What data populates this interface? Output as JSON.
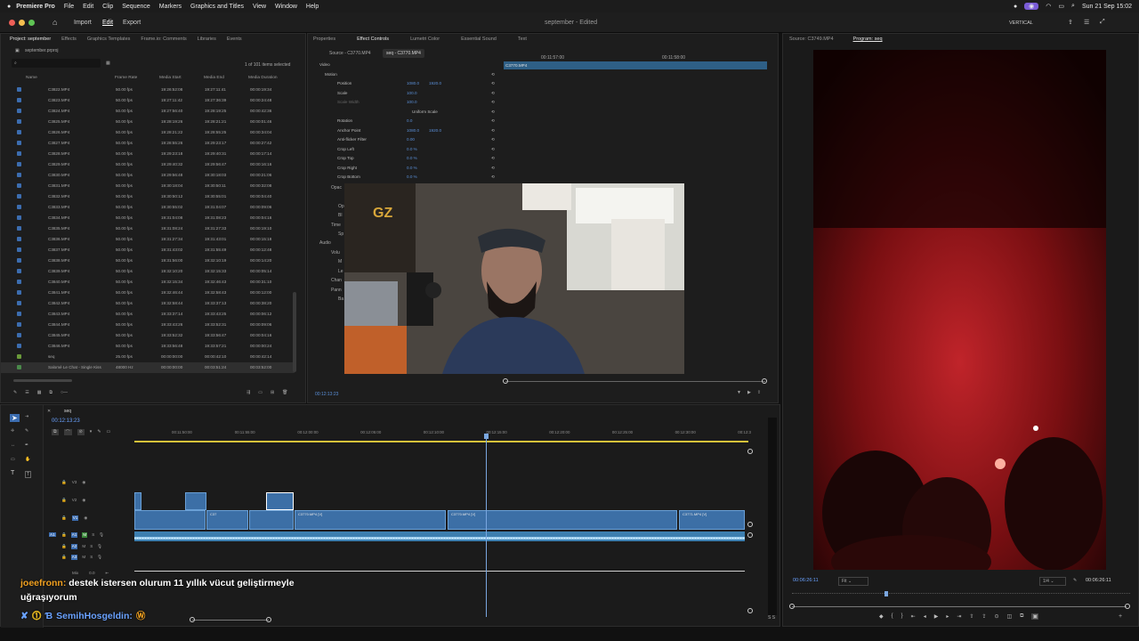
{
  "menubar": {
    "app": "Premiere Pro",
    "items": [
      "File",
      "Edit",
      "Clip",
      "Sequence",
      "Markers",
      "Graphics and Titles",
      "View",
      "Window",
      "Help"
    ],
    "datetime": "Sun 21 Sep  15:02"
  },
  "titlebar": {
    "nav": [
      "Import",
      "Edit",
      "Export"
    ],
    "title": "september - Edited",
    "workspace": "VERTICAL"
  },
  "project_panel": {
    "tabs": [
      "Project: september",
      "Effects",
      "Graphics Templates",
      "Frame.io: Comments",
      "Libraries",
      "Events"
    ],
    "file": "september.prproj",
    "items_selected": "1 of 101 items selected",
    "columns": [
      "Name",
      "Frame Rate",
      "Media Start",
      "Media End",
      "Media Duration"
    ],
    "rows": [
      [
        "C3822.MP4",
        "50.00 fps",
        "19:26:52:08",
        "19:27:11:41",
        "00:00:19:34"
      ],
      [
        "C3823.MP4",
        "50.00 fps",
        "19:27:11:42",
        "19:27:36:39",
        "00:00:24:48"
      ],
      [
        "C3824.MP4",
        "50.00 fps",
        "19:27:56:40",
        "19:28:19:25",
        "00:00:42:36"
      ],
      [
        "C3825.MP4",
        "50.00 fps",
        "19:28:19:26",
        "19:28:21:21",
        "00:00:01:46"
      ],
      [
        "C3826.MP4",
        "50.00 fps",
        "19:28:21:22",
        "19:28:55:25",
        "00:00:34:04"
      ],
      [
        "C3827.MP4",
        "50.00 fps",
        "19:28:55:26",
        "19:29:23:17",
        "00:00:27:42"
      ],
      [
        "C3828.MP4",
        "50.00 fps",
        "19:29:23:18",
        "19:29:40:31",
        "00:00:17:14"
      ],
      [
        "C3829.MP4",
        "50.00 fps",
        "19:29:40:32",
        "19:29:56:47",
        "00:00:16:16"
      ],
      [
        "C3830.MP4",
        "50.00 fps",
        "19:29:56:48",
        "19:30:18:03",
        "00:00:21:06"
      ],
      [
        "C3831.MP4",
        "50.00 fps",
        "19:30:18:04",
        "19:30:50:11",
        "00:00:32:08"
      ],
      [
        "C3832.MP4",
        "50.00 fps",
        "19:30:50:12",
        "19:30:55:01",
        "00:00:04:40"
      ],
      [
        "C3833.MP4",
        "50.00 fps",
        "19:30:55:02",
        "19:31:04:07",
        "00:00:09:06"
      ],
      [
        "C3834.MP4",
        "50.00 fps",
        "19:31:04:08",
        "19:31:08:23",
        "00:00:04:16"
      ],
      [
        "C3835.MP4",
        "50.00 fps",
        "19:31:08:24",
        "19:31:27:33",
        "00:00:19:10"
      ],
      [
        "C3836.MP4",
        "50.00 fps",
        "19:31:27:34",
        "19:31:43:01",
        "00:00:15:18"
      ],
      [
        "C3837.MP4",
        "50.00 fps",
        "19:31:43:02",
        "19:31:55:49",
        "00:00:12:48"
      ],
      [
        "C3838.MP4",
        "50.00 fps",
        "19:31:56:00",
        "19:32:10:19",
        "00:00:14:20"
      ],
      [
        "C3839.MP4",
        "50.00 fps",
        "19:32:10:20",
        "19:32:15:33",
        "00:00:05:14"
      ],
      [
        "C3840.MP4",
        "50.00 fps",
        "19:32:15:34",
        "19:32:46:43",
        "00:00:31:10"
      ],
      [
        "C3841.MP4",
        "50.00 fps",
        "19:32:46:44",
        "19:32:58:43",
        "00:00:12:00"
      ],
      [
        "C3842.MP4",
        "50.00 fps",
        "19:32:58:44",
        "19:33:37:13",
        "00:00:38:20"
      ],
      [
        "C3843.MP4",
        "50.00 fps",
        "19:33:37:14",
        "19:33:43:25",
        "00:00:06:12"
      ],
      [
        "C3844.MP4",
        "50.00 fps",
        "19:33:43:26",
        "19:33:52:31",
        "00:00:09:06"
      ],
      [
        "C3845.MP4",
        "50.00 fps",
        "19:33:52:32",
        "19:33:56:47",
        "00:00:04:16"
      ],
      [
        "C3846.MP4",
        "50.00 fps",
        "19:33:56:48",
        "19:33:57:21",
        "00:00:00:24"
      ],
      [
        "seq",
        "25.00 fps",
        "00:00:00:00",
        "00:00:42:10",
        "00:00:42:14"
      ],
      [
        "Salomé Le Chat - Single Kiss",
        "48000 Hz",
        "00:00:00:00",
        "00:03:51:24",
        "00:03:52:00"
      ]
    ]
  },
  "effect_controls": {
    "tabs": [
      "Properties",
      "Effect Controls",
      "Lumetri Color",
      "Essential Sound",
      "Text"
    ],
    "source_tabs": [
      "Source - C3770.MP4",
      "seq - C3770.MP4"
    ],
    "ruler": [
      "00:11:57:00",
      "00:11:58:00"
    ],
    "clip_name": "C3770.MP4",
    "timecode": "00:12:13:23",
    "rows": [
      {
        "label": "Video",
        "v1": "",
        "v2": ""
      },
      {
        "label": "Motion",
        "v1": "",
        "v2": ""
      },
      {
        "label": "Position",
        "v1": "1080.0",
        "v2": "1920.0"
      },
      {
        "label": "Scale",
        "v1": "100.0",
        "v2": ""
      },
      {
        "label": "Scale Width",
        "v1": "100.0",
        "v2": ""
      },
      {
        "label": "Uniform Scale",
        "v1": "",
        "v2": ""
      },
      {
        "label": "Rotation",
        "v1": "0.0",
        "v2": ""
      },
      {
        "label": "Anchor Point",
        "v1": "1080.0",
        "v2": "1920.0"
      },
      {
        "label": "Anti-flicker Filter",
        "v1": "0.00",
        "v2": ""
      },
      {
        "label": "Crop Left",
        "v1": "0.0 %",
        "v2": ""
      },
      {
        "label": "Crop Top",
        "v1": "0.0 %",
        "v2": ""
      },
      {
        "label": "Crop Right",
        "v1": "0.0 %",
        "v2": ""
      },
      {
        "label": "Crop Bottom",
        "v1": "0.0 %",
        "v2": ""
      }
    ],
    "truncated": [
      "Opac",
      "Op",
      "Bl",
      "Time",
      "Sp",
      "Audio",
      "Volu",
      "M",
      "Le",
      "Chan",
      "Pann",
      "Ba"
    ]
  },
  "timeline": {
    "tab": "seq",
    "timecode": "00:12:13:23",
    "ruler": [
      "00:11:50:00",
      "00:11:55:00",
      "00:12:00:00",
      "00:12:05:00",
      "00:12:10:00",
      "00:12:15:00",
      "00:12:20:00",
      "00:12:25:00",
      "00:12:30:00",
      "00:12:3"
    ],
    "tracks": [
      "V3",
      "V2",
      "V1",
      "A1",
      "A2",
      "A3",
      "Mix"
    ],
    "source_label_v": "V1",
    "source_label_a": "A1",
    "mix_value": "0.0",
    "clips_v1": [
      "C37",
      "C3770.MP4 [V]",
      "C3770.MP4 [V]",
      "C3771.MP4 [V]"
    ],
    "meter_label": "S S"
  },
  "program_monitor": {
    "tabs": [
      "Source: C3749.MP4",
      "Program: seq"
    ],
    "timecode_left": "00:06:26:11",
    "fit": "Fit",
    "quality": "1/4",
    "timecode_right": "00:06:26:11"
  },
  "chat": {
    "user1": "joeefronn:",
    "msg1": "destek istersen olurum 11 yıllık vücut geliştirmeyle uğraşıyorum",
    "user2": "SemihHosgeldin:"
  },
  "colors": {
    "accent": "#3c6db0",
    "clip_blue": "#3c6fa6",
    "playhead": "#7aa7e0",
    "chat_orange": "#f0a020",
    "chat_blue": "#6aa2ff"
  }
}
